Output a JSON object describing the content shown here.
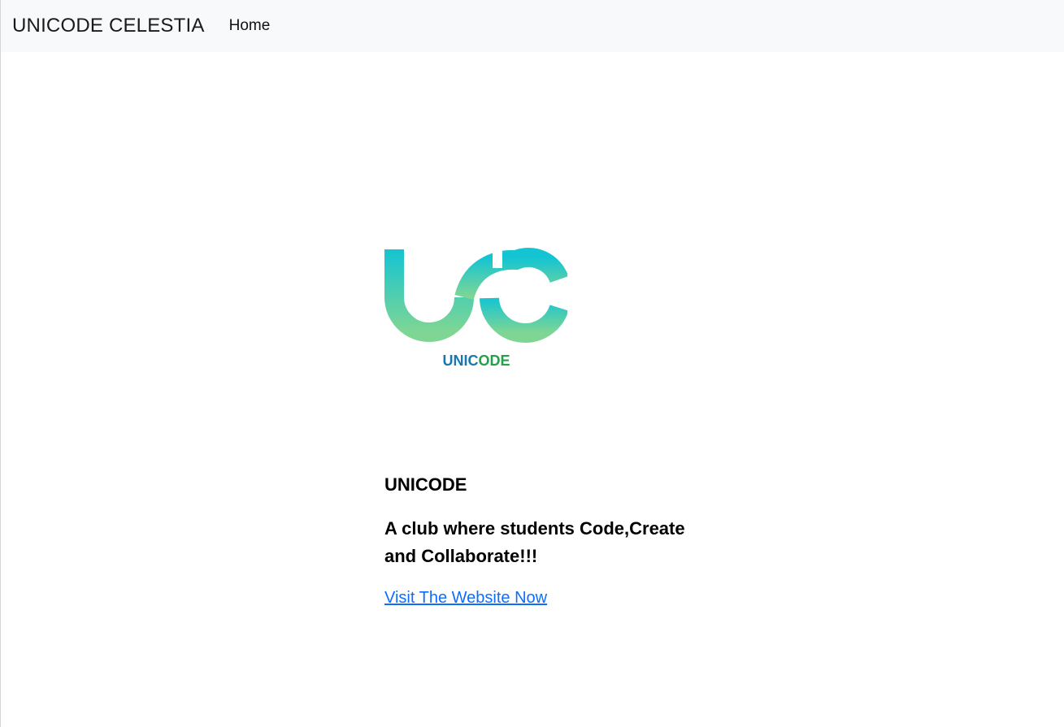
{
  "navbar": {
    "brand": "UNICODE CELESTIA",
    "links": [
      {
        "label": "Home"
      }
    ]
  },
  "logo": {
    "wordmark": "UNICODE",
    "colors": {
      "teal": "#14c4d2",
      "green": "#7fd694",
      "blue": "#1877b3",
      "dark_green": "#25a04a"
    }
  },
  "card": {
    "title": "UNICODE",
    "tagline": "A club where students Code,Create and Collaborate!!!",
    "link_label": "Visit The Website Now"
  },
  "colors": {
    "link": "#0d6efd",
    "navbar_bg": "#f8f9fa"
  }
}
